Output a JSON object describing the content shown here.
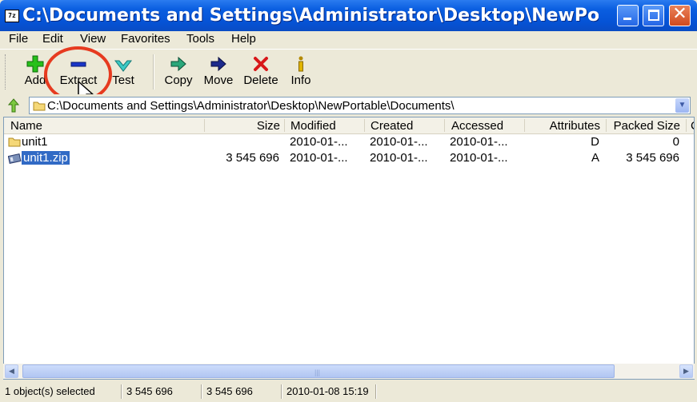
{
  "window": {
    "title": "C:\\Documents and Settings\\Administrator\\Desktop\\NewPortable\\D...",
    "app_icon_label": "7z"
  },
  "menu": [
    "File",
    "Edit",
    "View",
    "Favorites",
    "Tools",
    "Help"
  ],
  "toolbar": {
    "add": "Add",
    "extract": "Extract",
    "test": "Test",
    "copy": "Copy",
    "move": "Move",
    "delete": "Delete",
    "info": "Info"
  },
  "address": {
    "path": "C:\\Documents and Settings\\Administrator\\Desktop\\NewPortable\\Documents\\"
  },
  "columns": [
    "Name",
    "Size",
    "Modified",
    "Created",
    "Accessed",
    "Attributes",
    "Packed Size",
    "C"
  ],
  "rows": [
    {
      "name": "unit1",
      "size": "",
      "modified": "2010-01-...",
      "created": "2010-01-...",
      "accessed": "2010-01-...",
      "attributes": "D",
      "packed": "0"
    },
    {
      "name": "unit1.zip",
      "size": "3 545 696",
      "modified": "2010-01-...",
      "created": "2010-01-...",
      "accessed": "2010-01-...",
      "attributes": "A",
      "packed": "3 545 696"
    }
  ],
  "status": {
    "selected": "1 object(s) selected",
    "size": "3 545 696",
    "packed": "3 545 696",
    "date": "2010-01-08 15:19"
  },
  "colors": {
    "title_blue": "#0553d6",
    "selection": "#316ac5",
    "highlight_circle": "#e63a1f"
  }
}
